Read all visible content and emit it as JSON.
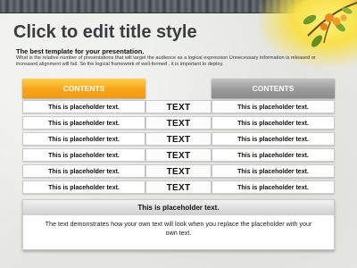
{
  "slide": {
    "title": "Click to edit title style",
    "subtitle": "The best template for your presentation.",
    "description": "What is the relative number of presentations that will target the audience as a logical expression Unnecessary information is released or increased alignment will fail. So the logical framework of well-formed , it is important to deploy."
  },
  "table": {
    "left_header": "CONTENTS",
    "right_header": "CONTENTS",
    "rows": [
      {
        "left": "This is placeholder text.",
        "mid": "TEXT",
        "right": "This is placeholder text."
      },
      {
        "left": "This is placeholder text.",
        "mid": "TEXT",
        "right": "This is placeholder text."
      },
      {
        "left": "This is placeholder text.",
        "mid": "TEXT",
        "right": "This is placeholder text."
      },
      {
        "left": "This is placeholder text.",
        "mid": "TEXT",
        "right": "This is placeholder text."
      },
      {
        "left": "This is placeholder text.",
        "mid": "TEXT",
        "right": "This is placeholder text."
      },
      {
        "left": "This is placeholder text.",
        "mid": "TEXT",
        "right": "This is placeholder text."
      }
    ]
  },
  "footer_box": {
    "heading": "This is placeholder text.",
    "text": "The text demonstrates how your own text will look when you replace the placeholder with your own text."
  },
  "colors": {
    "left_header": "#f7a51c",
    "right_header": "#9a9a9a",
    "title": "#3a3d40"
  },
  "icons": [
    "chain-border-decoration",
    "citrus-branch-decoration"
  ]
}
